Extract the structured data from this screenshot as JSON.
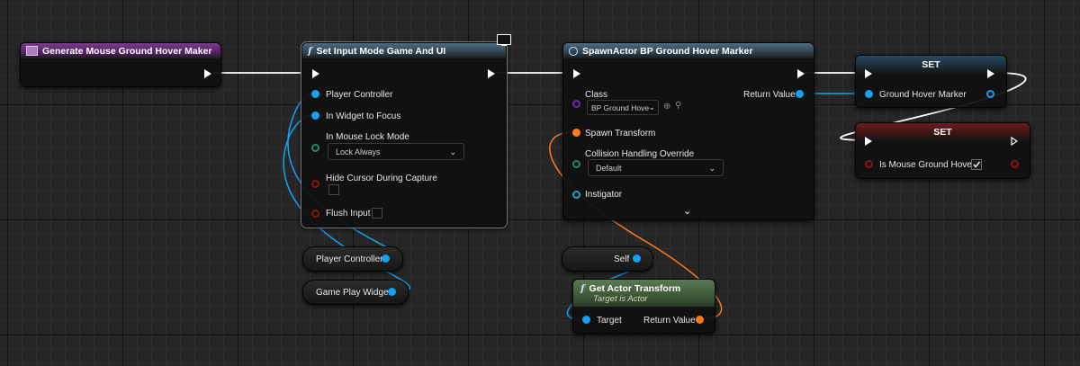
{
  "nodes": {
    "event": {
      "title": "Generate Mouse Ground Hover Maker"
    },
    "set_input_mode": {
      "title": "Set Input Mode Game And UI",
      "pins": {
        "player_controller": "Player Controller",
        "in_widget_to_focus": "In Widget to Focus",
        "in_mouse_lock_mode": "In Mouse Lock Mode",
        "mouse_lock_value": "Lock Always",
        "hide_cursor": "Hide Cursor During Capture",
        "flush_input": "Flush Input"
      }
    },
    "spawn_actor": {
      "title": "SpawnActor BP Ground Hover Marker",
      "pins": {
        "class": "Class",
        "class_value": "BP Ground Hove",
        "return_value": "Return Value",
        "spawn_transform": "Spawn Transform",
        "collision_override": "Collision Handling Override",
        "collision_value": "Default",
        "instigator": "Instigator"
      }
    },
    "set_marker": {
      "title": "SET",
      "pin": "Ground Hover Marker"
    },
    "set_hover": {
      "title": "SET",
      "pin": "Is Mouse Ground Hover",
      "checked": true
    },
    "var_player_controller": {
      "label": "Player Controller"
    },
    "var_widget": {
      "label": "Game Play Widget"
    },
    "var_self": {
      "label": "Self"
    },
    "get_actor_transform": {
      "title": "Get Actor Transform",
      "subtitle": "Target is Actor",
      "pins": {
        "target": "Target",
        "return_value": "Return Value"
      }
    }
  },
  "colors": {
    "exec": "#ffffff",
    "object_pin": "#13a2f2",
    "transform_pin": "#ff7a1a",
    "class_pin": "#6a2cb0",
    "byte_pin": "#1f8a6a",
    "bool_pin": "#8a1414"
  },
  "icons": [
    "function-icon",
    "monitor-icon",
    "event-icon",
    "search-icon",
    "clear-icon",
    "expand-arrow-icon"
  ]
}
